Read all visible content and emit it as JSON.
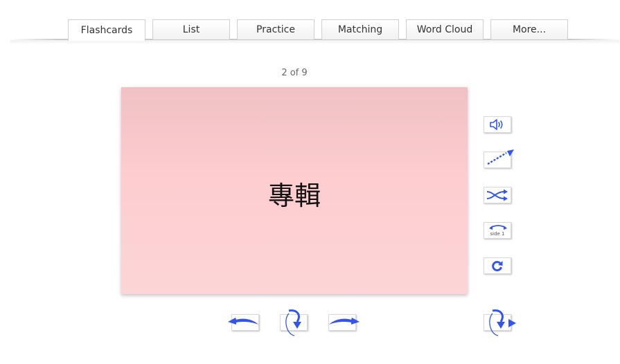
{
  "tabs": [
    {
      "label": "Flashcards",
      "active": true
    },
    {
      "label": "List",
      "active": false
    },
    {
      "label": "Practice",
      "active": false
    },
    {
      "label": "Matching",
      "active": false
    },
    {
      "label": "Word Cloud",
      "active": false
    },
    {
      "label": "More...",
      "active": false
    }
  ],
  "counter": "2 of 9",
  "card": {
    "term": "專輯",
    "colors": {
      "top": "#f0c1c4",
      "bottom": "#fdd5d7"
    }
  },
  "side_controls": {
    "audio": {
      "icon": "speaker-icon"
    },
    "fullscreen": {
      "icon": "expand-arrow-icon"
    },
    "shuffle": {
      "icon": "shuffle-icon"
    },
    "side_toggle": {
      "icon": "swap-sides-icon",
      "label": "side 1"
    },
    "restart": {
      "icon": "restart-icon"
    }
  },
  "nav_controls": {
    "prev": {
      "icon": "arrow-left-icon"
    },
    "flip": {
      "icon": "flip-icon"
    },
    "next": {
      "icon": "arrow-right-icon"
    },
    "autoplay": {
      "icon": "autoplay-icon"
    }
  },
  "accent_color": "#3355ee"
}
